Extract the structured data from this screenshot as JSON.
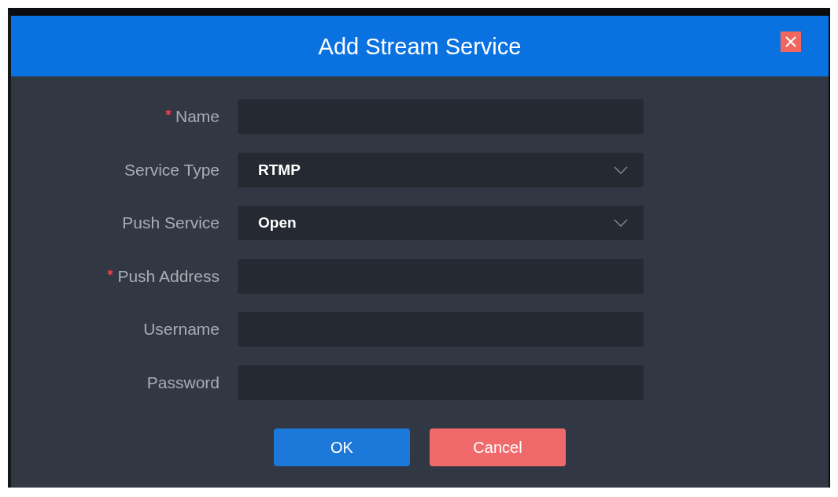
{
  "dialog": {
    "title": "Add Stream Service"
  },
  "fields": [
    {
      "label": "Name",
      "required": true,
      "kind": "text"
    },
    {
      "label": "Service Type",
      "required": false,
      "kind": "select",
      "value": "RTMP"
    },
    {
      "label": "Push Service",
      "required": false,
      "kind": "select",
      "value": "Open"
    },
    {
      "label": "Push Address",
      "required": true,
      "kind": "text"
    },
    {
      "label": "Username",
      "required": false,
      "kind": "text"
    },
    {
      "label": "Password",
      "required": false,
      "kind": "text"
    }
  ],
  "buttons": [
    {
      "label": "OK",
      "kind": "primary"
    },
    {
      "label": "Cancel",
      "kind": "danger"
    }
  ]
}
